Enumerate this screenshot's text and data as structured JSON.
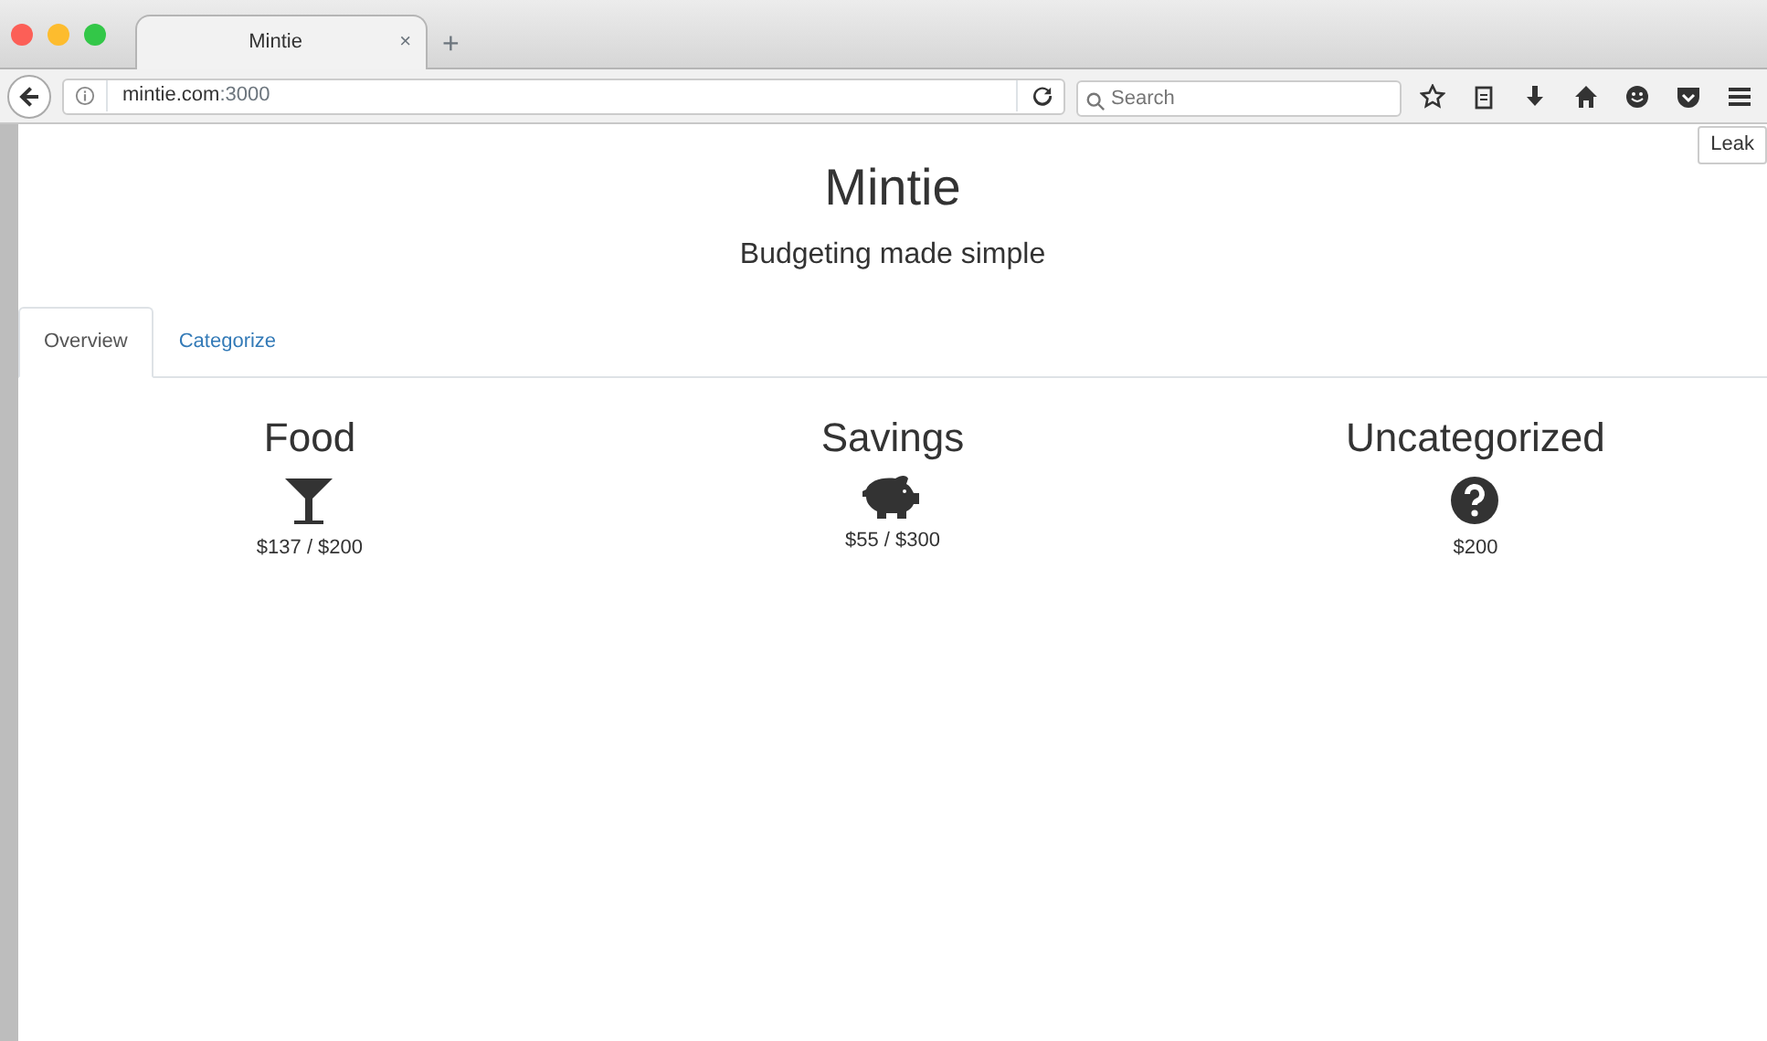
{
  "browser": {
    "tab_title": "Mintie",
    "tab_close": "×",
    "new_tab": "+",
    "url_host": "mintie.com",
    "url_rest": ":3000",
    "search_placeholder": "Search",
    "tooltip": "Leak"
  },
  "header": {
    "title": "Mintie",
    "subtitle": "Budgeting made simple"
  },
  "tabs": [
    {
      "label": "Overview",
      "selected": true
    },
    {
      "label": "Categorize",
      "selected": false
    }
  ],
  "categories": [
    {
      "name": "Food",
      "kind": "glass",
      "amount": "$137 / $200"
    },
    {
      "name": "Savings",
      "kind": "piggy",
      "amount": "$55 / $300"
    },
    {
      "name": "Uncategorized",
      "kind": "question",
      "amount": "$200"
    }
  ]
}
